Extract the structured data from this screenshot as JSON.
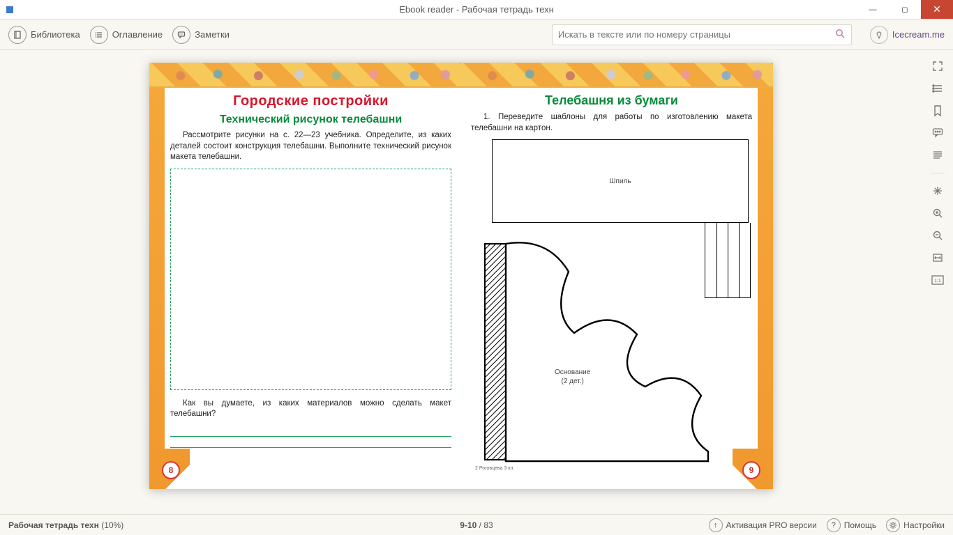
{
  "titlebar": {
    "title": "Ebook reader - Рабочая тетрадь техн"
  },
  "toolbar": {
    "library": "Библиотека",
    "toc": "Оглавление",
    "notes": "Заметки",
    "search_placeholder": "Искать в тексте или по номеру страницы",
    "brand": "Icecream.me"
  },
  "left_page": {
    "heading1": "Городские постройки",
    "heading2": "Технический рисунок телебашни",
    "para": "Рассмотрите рисунки на с. 22—23 учебника. Определите, из каких деталей состоит конструкция телебашни. Выполните технический рисунок макета телебашни.",
    "question": "Как вы думаете, из каких материалов можно сделать макет телебашни?",
    "page_num": "8"
  },
  "right_page": {
    "heading": "Телебашня из бумаги",
    "para": "1. Переведите шаблоны для работы по изготовлению макета телебашни на картон.",
    "spire_label": "Шпиль",
    "base_label_l1": "Основание",
    "base_label_l2": "(2 дет.)",
    "footnote": "2   Роговцева 3 кл",
    "page_num": "9"
  },
  "status": {
    "book": "Рабочая тетрадь техн",
    "progress": "(10%)",
    "page_current": "9-10",
    "page_sep": " / ",
    "page_total": "83",
    "pro": "Активация PRO версии",
    "help": "Помощь",
    "settings": "Настройки"
  }
}
